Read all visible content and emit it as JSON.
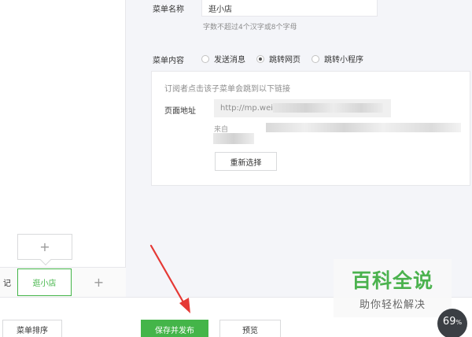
{
  "left_panel": {
    "add_submenu_symbol": "+",
    "menu_bar": {
      "left_fragment": "记",
      "active_item": "逛小店",
      "add_symbol": "+"
    }
  },
  "editor": {
    "name_label": "菜单名称",
    "name_value": "逛小店",
    "name_hint": "字数不超过4个汉字或8个字母",
    "content_label": "菜单内容",
    "content_options": [
      {
        "label": "发送消息",
        "selected": false
      },
      {
        "label": "跳转网页",
        "selected": true
      },
      {
        "label": "跳转小程序",
        "selected": false
      }
    ],
    "link_box": {
      "hint": "订阅者点击该子菜单会跳到以下链接",
      "address_label": "页面地址",
      "address_value": "http://mp.wei",
      "source_prefix": "来自",
      "reselect_label": "重新选择"
    }
  },
  "toolbar": {
    "sort_label": "菜单排序",
    "save_label": "保存并发布",
    "preview_label": "预览"
  },
  "watermark": {
    "title": "百科全说",
    "subtitle": "助你轻松解决"
  },
  "badge": {
    "value": "69",
    "unit": "%"
  },
  "colors": {
    "accent_green": "#44b549",
    "arrow_red": "#e53935",
    "panel_bg": "#f4f5f9"
  }
}
